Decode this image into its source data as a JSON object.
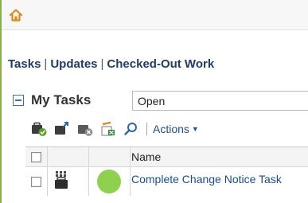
{
  "nav": {
    "tabs": [
      {
        "label": "Tasks"
      },
      {
        "label": "Updates"
      },
      {
        "label": "Checked-Out Work"
      }
    ]
  },
  "my_tasks": {
    "title": "My Tasks",
    "filter_value": "Open"
  },
  "toolbar": {
    "icons": [
      "complete-task-icon",
      "reassign-task-icon",
      "cancel-task-icon",
      "export-icon",
      "search-icon"
    ],
    "actions_label": "Actions"
  },
  "table": {
    "columns": [
      {
        "label": ""
      },
      {
        "label": ""
      },
      {
        "label": ""
      },
      {
        "label": "Name"
      }
    ],
    "rows": [
      {
        "name": "Complete Change Notice Task",
        "status_color": "#8fd14f"
      }
    ]
  },
  "colors": {
    "accent": "#1f3c66",
    "link": "#1a4d8f",
    "home_icon": "#d98a14",
    "status_ok": "#8fd14f"
  }
}
